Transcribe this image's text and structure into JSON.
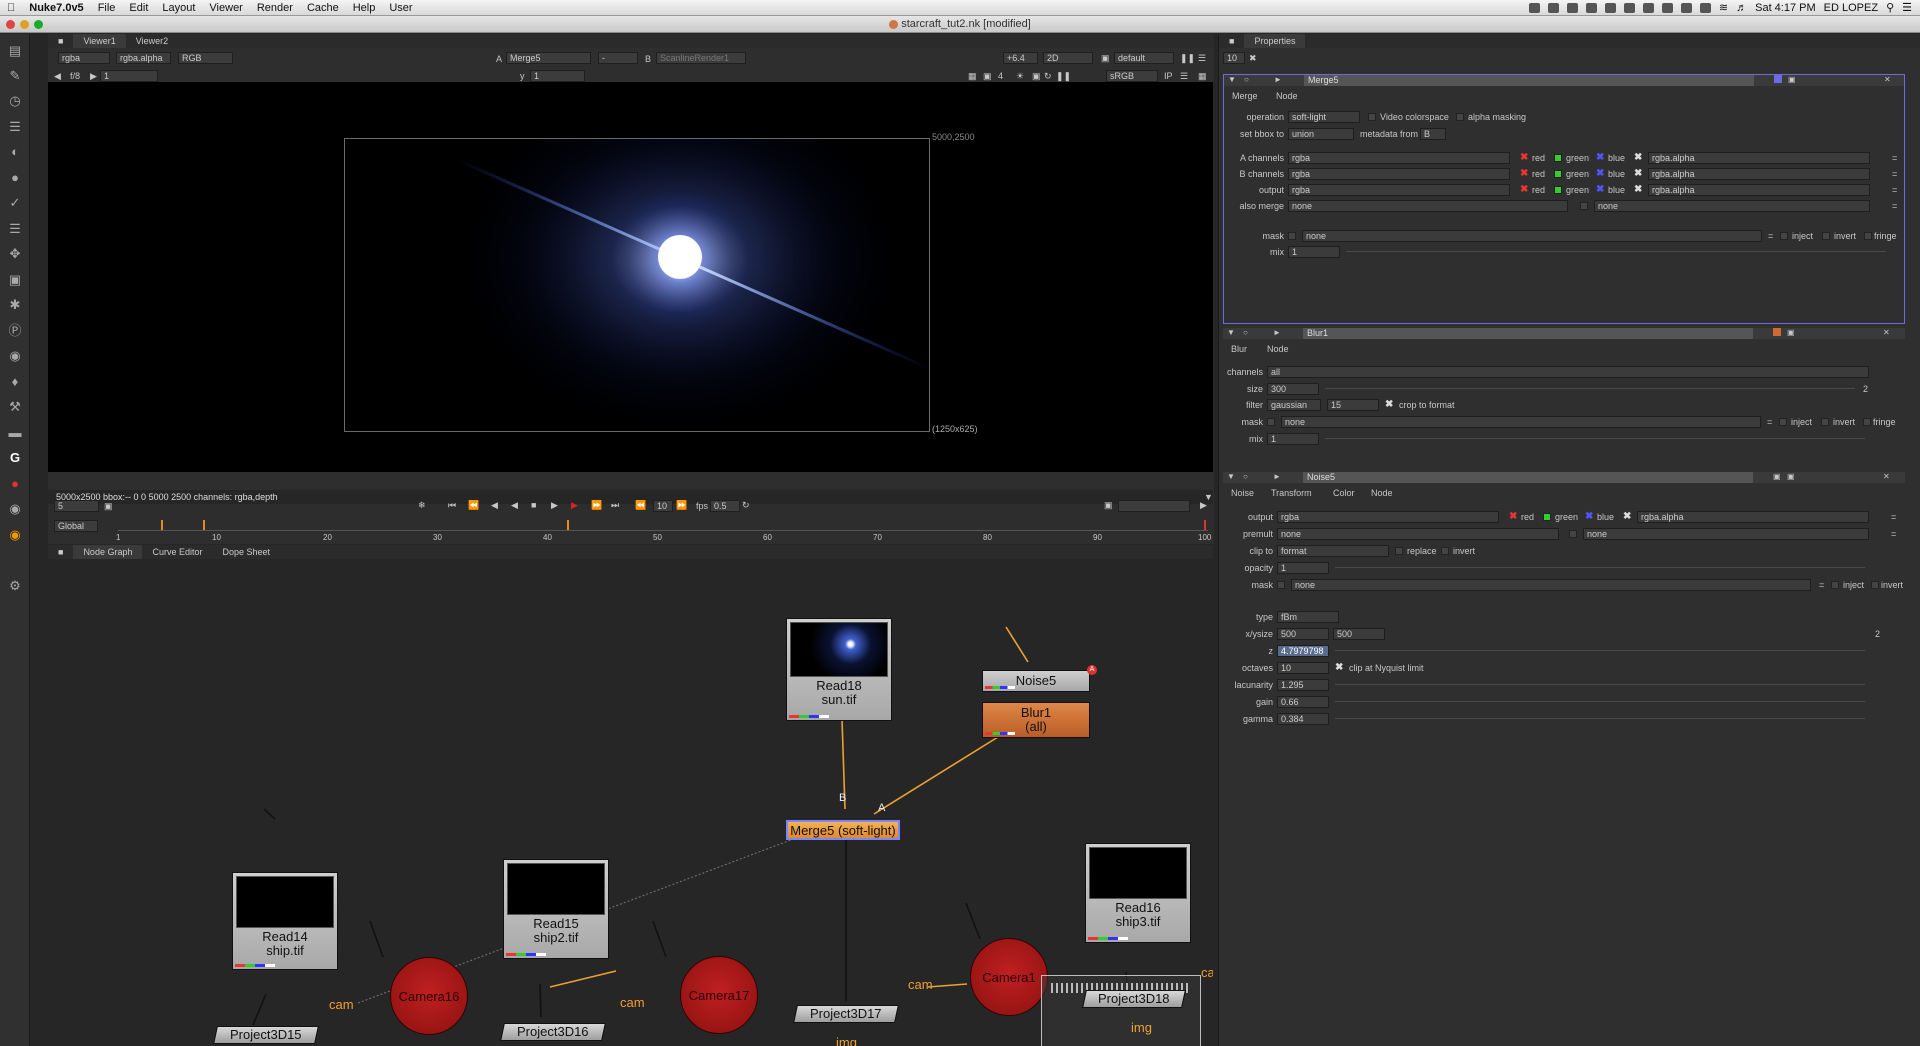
{
  "menubar": {
    "app": "Nuke7.0v5",
    "items": [
      "File",
      "Edit",
      "Layout",
      "Viewer",
      "Render",
      "Cache",
      "Help",
      "User"
    ],
    "clock": "Sat 4:17 PM",
    "user": "ED LOPEZ"
  },
  "window": {
    "title": "starcraft_tut2.nk [modified]"
  },
  "viewer": {
    "tabs": [
      "Viewer1",
      "Viewer2"
    ],
    "channels": "rgba",
    "alpha": "rgba.alpha",
    "display": "RGB",
    "a_label": "A",
    "a_input": "Merge5",
    "wipe": "-",
    "b_label": "B",
    "b_input": "ScanlineRender1",
    "gain": "+6.4",
    "mode": "2D",
    "lut_default": "default",
    "fstop": "f/8",
    "frame_in": "1",
    "y_label": "y",
    "y_value": "1",
    "proxy": "4",
    "colorspace": "sRGB",
    "format_top": "5000,2500",
    "format_bottom": "(1250x625)",
    "info_line": "5000x2500 bbox:-- 0 0 5000 2500 channels: rgba,depth"
  },
  "timeline": {
    "frame": "5",
    "step": "10",
    "fps_label": "fps",
    "fps": "0.5",
    "range": "Global",
    "ticks": [
      "1",
      "10",
      "20",
      "30",
      "40",
      "50",
      "60",
      "70",
      "80",
      "90",
      "100"
    ]
  },
  "nodegraph": {
    "tabs": [
      "Node Graph",
      "Curve Editor",
      "Dope Sheet"
    ],
    "nodes": {
      "read18": {
        "name": "Read18",
        "file": "sun.tif"
      },
      "read14": {
        "name": "Read14",
        "file": "ship.tif"
      },
      "read15": {
        "name": "Read15",
        "file": "ship2.tif"
      },
      "read16": {
        "name": "Read16",
        "file": "ship3.tif"
      },
      "noise5": "Noise5",
      "blur1": {
        "name": "Blur1",
        "sub": "(all)"
      },
      "merge5": "Merge5 (soft-light)",
      "camera16": "Camera16",
      "camera17": "Camera17",
      "camera18": "Camera1",
      "project15": "Project3D15",
      "project16": "Project3D16",
      "project17": "Project3D17",
      "project18": "Project3D18"
    },
    "edge_labels": {
      "b": "B",
      "a": "A",
      "cam": "cam",
      "img": "img"
    }
  },
  "properties": {
    "title": "Properties",
    "max_panels": "10",
    "merge5": {
      "name": "Merge5",
      "tabs": [
        "Merge",
        "Node"
      ],
      "operation_label": "operation",
      "operation": "soft-light",
      "video_colorspace": "Video colorspace",
      "alpha_masking": "alpha masking",
      "set_bbox_label": "set bbox to",
      "set_bbox": "union",
      "metadata_label": "metadata from",
      "metadata": "B",
      "a_channels_label": "A channels",
      "b_channels_label": "B channels",
      "output_label": "output",
      "also_merge_label": "also merge",
      "rgba": "rgba",
      "red": "red",
      "green": "green",
      "blue": "blue",
      "rgba_alpha": "rgba.alpha",
      "none": "none",
      "mask_label": "mask",
      "inject": "inject",
      "invert": "invert",
      "fringe": "fringe",
      "mix_label": "mix",
      "mix": "1"
    },
    "blur1": {
      "name": "Blur1",
      "tabs": [
        "Blur",
        "Node"
      ],
      "channels_label": "channels",
      "channels": "all",
      "size_label": "size",
      "size": "300",
      "size_right": "2",
      "filter_label": "filter",
      "filter": "gaussian",
      "quality": "15",
      "crop_label": "crop to format",
      "mask_label": "mask",
      "mask": "none",
      "mix_label": "mix",
      "mix": "1"
    },
    "noise5": {
      "name": "Noise5",
      "tabs": [
        "Noise",
        "Transform",
        "Color",
        "Node"
      ],
      "output_label": "output",
      "premult_label": "premult",
      "clip_label": "clip to",
      "clip": "format",
      "replace": "replace",
      "invert": "invert",
      "opacity_label": "opacity",
      "opacity": "1",
      "mask_label": "mask",
      "type_label": "type",
      "type": "fBm",
      "xysize_label": "x/ysize",
      "xsize": "500",
      "ysize": "500",
      "xysize_right": "2",
      "z_label": "z",
      "z": "4.7979798",
      "octaves_label": "octaves",
      "octaves": "10",
      "nyquist": "clip at Nyquist limit",
      "lacunarity_label": "lacunarity",
      "lacunarity": "1.295",
      "gain_label": "gain",
      "gain": "0.66",
      "gamma_label": "gamma",
      "gamma": "0.384"
    }
  }
}
